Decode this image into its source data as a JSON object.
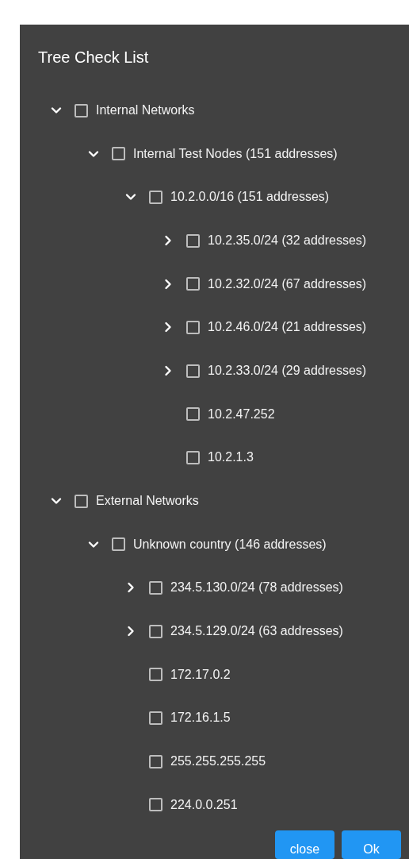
{
  "dialog": {
    "title": "Tree Check List"
  },
  "tree": [
    {
      "label": "Internal Networks",
      "checked": false,
      "expanded": true,
      "children": [
        {
          "label": "Internal Test Nodes (151 addresses)",
          "checked": false,
          "expanded": true,
          "children": [
            {
              "label": "10.2.0.0/16 (151 addresses)",
              "checked": false,
              "expanded": true,
              "children": [
                {
                  "label": "10.2.35.0/24 (32 addresses)",
                  "checked": false,
                  "expanded": false
                },
                {
                  "label": "10.2.32.0/24 (67 addresses)",
                  "checked": false,
                  "expanded": false
                },
                {
                  "label": "10.2.46.0/24 (21 addresses)",
                  "checked": false,
                  "expanded": false
                },
                {
                  "label": "10.2.33.0/24 (29 addresses)",
                  "checked": false,
                  "expanded": false
                },
                {
                  "label": "10.2.47.252",
                  "checked": false
                },
                {
                  "label": "10.2.1.3",
                  "checked": false
                }
              ]
            }
          ]
        }
      ]
    },
    {
      "label": "External Networks",
      "checked": false,
      "expanded": true,
      "children": [
        {
          "label": "Unknown country (146 addresses)",
          "checked": false,
          "expanded": true,
          "children": [
            {
              "label": "234.5.130.0/24 (78 addresses)",
              "checked": false,
              "expanded": false
            },
            {
              "label": "234.5.129.0/24 (63 addresses)",
              "checked": false,
              "expanded": false
            },
            {
              "label": "172.17.0.2",
              "checked": false
            },
            {
              "label": "172.16.1.5",
              "checked": false
            },
            {
              "label": "255.255.255.255",
              "checked": false
            },
            {
              "label": "224.0.0.251",
              "checked": false
            }
          ]
        }
      ]
    }
  ],
  "buttons": [
    {
      "label": "close"
    },
    {
      "label": "Ok"
    }
  ]
}
